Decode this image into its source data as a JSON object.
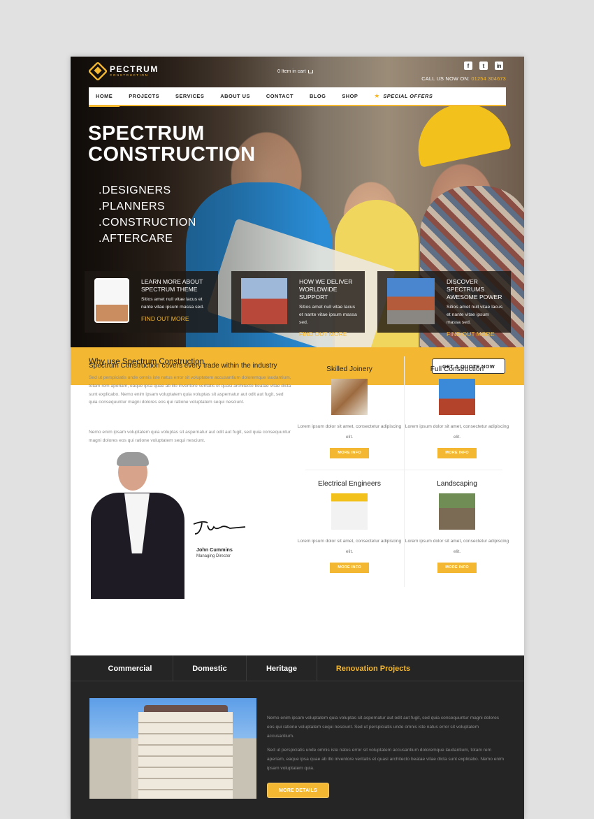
{
  "header": {
    "logo_title": "PECTRUM",
    "logo_subtitle": "CONSTRUCTION",
    "cart_text": "0 Item in cart",
    "social": [
      "f",
      "t",
      "in"
    ],
    "call_label": "CALL US NOW ON:",
    "call_number": "01254 304673"
  },
  "nav": {
    "items": [
      "HOME",
      "PROJECTS",
      "SERVICES",
      "ABOUT US",
      "CONTACT",
      "BLOG",
      "SHOP"
    ],
    "special": "SPECIAL OFFERS"
  },
  "hero": {
    "title_line1": "SPECTRUM",
    "title_line2": "CONSTRUCTION",
    "list": [
      ".DESIGNERS",
      ".PLANNERS",
      ".CONSTRUCTION",
      ".AFTERCARE"
    ]
  },
  "features": [
    {
      "heading": "LEARN MORE ABOUT SPECTRUM THEME",
      "desc": "Sitios amet null vitae lacus et nante vitae ipsum massa sed.",
      "link": "FIND OUT MORE"
    },
    {
      "heading": "HOW WE DELIVER WORLDWIDE SUPPORT",
      "desc": "Sitios amet null vitae lacus et nante vitae ipsum massa sed.",
      "link": "FIND OUT MORE"
    },
    {
      "heading": "DISCOVER SPECTRUMS AWESOME POWER",
      "desc": "Sitios amet null vitae lacus et nante vitae ipsum massa sed.",
      "link": "FIND OUT MORE"
    }
  ],
  "quote": {
    "text": "Spectrum Construction covers every trade within the industry",
    "button": "GET A QUOTE NOW"
  },
  "why": {
    "title": "Why use Spectrum Construction",
    "p1": "Sed ut perspiciatis unde omnis iste natus error sit voluptatem accusantium doloremque laudantium, totam rem aperiam, eaque ipsa quae ab illo inventore veritatis et quasi architecto beatae vitae dicta sunt explicabo. Nemo enim ipsam voluptatem quia voluptas sit aspernatur aut odit aut fugit, sed quia consequuntur magni dolores eos qui ratione voluptatem sequi nesciunt.",
    "p2": "Nemo enim ipsam voluptatem quia voluptas sit aspernatur aut odit aut fugit, sed quia consequuntur magni dolores eos qui ratione voluptatem sequi nesciunt.",
    "person_name": "John Cummins",
    "person_role": "Managing Director"
  },
  "services": [
    {
      "title": "Skilled Joinery",
      "desc": "Lorem ipsum dolor sit amet, consectetur adipiscing elit.",
      "button": "MORE INFO"
    },
    {
      "title": "Full Construction",
      "desc": "Lorem ipsum dolor sit amet, consectetur adipiscing elit.",
      "button": "MORE INFO"
    },
    {
      "title": "Electrical Engineers",
      "desc": "Lorem ipsum dolor sit amet, consectetur adipiscing elit.",
      "button": "MORE INFO"
    },
    {
      "title": "Landscaping",
      "desc": "Lorem ipsum dolor sit amet, consectetur adipiscing elit.",
      "button": "MORE INFO"
    }
  ],
  "projects": {
    "tabs": [
      "Commercial",
      "Domestic",
      "Heritage",
      "Renovation Projects"
    ],
    "p1": "Nemo enim ipsam voluptatem quia voluptas sit aspernatur aut odit aut fugit, sed quia consequuntur magni dolores eos qui ratione voluptatem sequi nesciunt. Sed ut perspiciatis unde omnis iste natus error sit voluptatem accusantium.",
    "p2": "Sed ut perspiciatis unde omnis iste natus error sit voluptatem accusantium doloremque laudantium, totam rem aperiam, eaque ipsa quae ab illo inventore veritatis et quasi architecto beatae vitae dicta sunt explicabo. Nemo enim ipsam voluptatem quia.",
    "button": "MORE DETAILS"
  },
  "colors": {
    "accent": "#f4b731",
    "dark": "#252525"
  }
}
